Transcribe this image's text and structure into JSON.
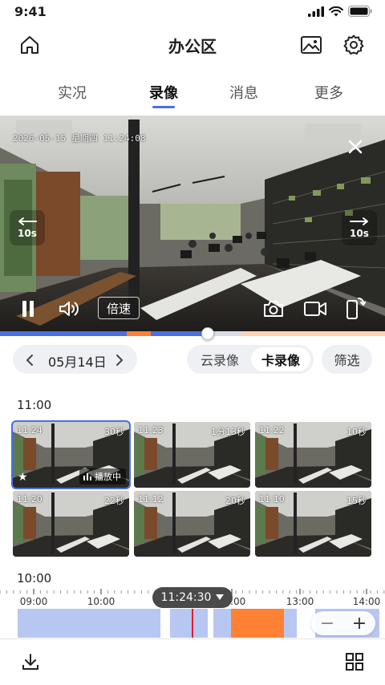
{
  "status": {
    "time": "9:41"
  },
  "header": {
    "title": "办公区"
  },
  "tabs": [
    {
      "label": "实况"
    },
    {
      "label": "录像"
    },
    {
      "label": "消息"
    },
    {
      "label": "更多"
    }
  ],
  "player": {
    "osd": "2026-05-15 星期四 11:24:08",
    "rewind_label": "10s",
    "forward_label": "10s",
    "speed_label": "倍速",
    "progress_fraction": 0.54
  },
  "date_bar": {
    "date": "05月14日",
    "cloud_label": "云录像",
    "card_label": "卡录像",
    "filter_label": "筛选"
  },
  "groups": [
    {
      "hour": "11:00",
      "clips": [
        {
          "time": "11:24",
          "duration": "30秒",
          "playing": true,
          "starred": true,
          "playing_label": "播放中"
        },
        {
          "time": "11:23",
          "duration": "1分13秒"
        },
        {
          "time": "11:22",
          "duration": "10秒"
        },
        {
          "time": "11:20",
          "duration": "22秒"
        },
        {
          "time": "11:12",
          "duration": "20秒"
        },
        {
          "time": "11:10",
          "duration": "15秒"
        }
      ]
    },
    {
      "hour": "10:00",
      "clips": []
    }
  ],
  "timeline": {
    "ticks": [
      "09:00",
      "10:00",
      "12:00",
      "13:00",
      "14:00"
    ],
    "current": "11:24:30",
    "colors": {
      "normal": "#b8c6f2",
      "event": "#ff8133",
      "cursor": "#e0202a"
    }
  },
  "colors": {
    "accent": "#4a6fe0"
  },
  "icons": [
    "home-icon",
    "gallery-icon",
    "settings-icon",
    "close-icon",
    "pause-icon",
    "volume-icon",
    "snapshot-icon",
    "record-icon",
    "rotate-icon",
    "download-icon",
    "grid-icon"
  ]
}
